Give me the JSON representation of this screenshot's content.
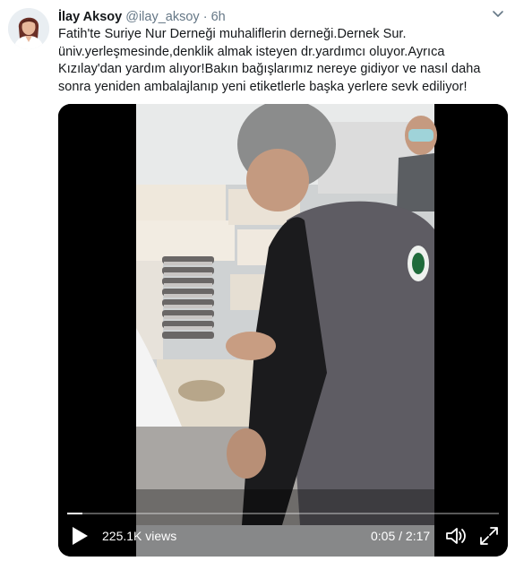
{
  "tweet": {
    "display_name": "İlay Aksoy",
    "handle": "@ilay_aksoy",
    "separator": "·",
    "timestamp": "6h",
    "lines": [
      "Fatih'te Suriye Nur Derneği muhaliflerin derneği.Dernek Sur.",
      "üniv.yerleşmesinde,denklik almak isteyen dr.yardımcı oluyor.Ayrıca",
      "Kızılay'dan yardım alıyor!Bakın bağışlarımız nereye gidiyor ve nasıl daha",
      "sonra yeniden ambalajlanıp yeni etiketlerle başka yerlere sevk ediliyor!"
    ]
  },
  "video": {
    "views": "225.1K views",
    "current_time": "0:05",
    "duration": "2:17",
    "time_separator": " / ",
    "progress": 0.036
  },
  "icons": {
    "more": "chevron-down-icon",
    "play": "play-icon",
    "volume": "volume-icon",
    "fullscreen": "fullscreen-icon"
  }
}
